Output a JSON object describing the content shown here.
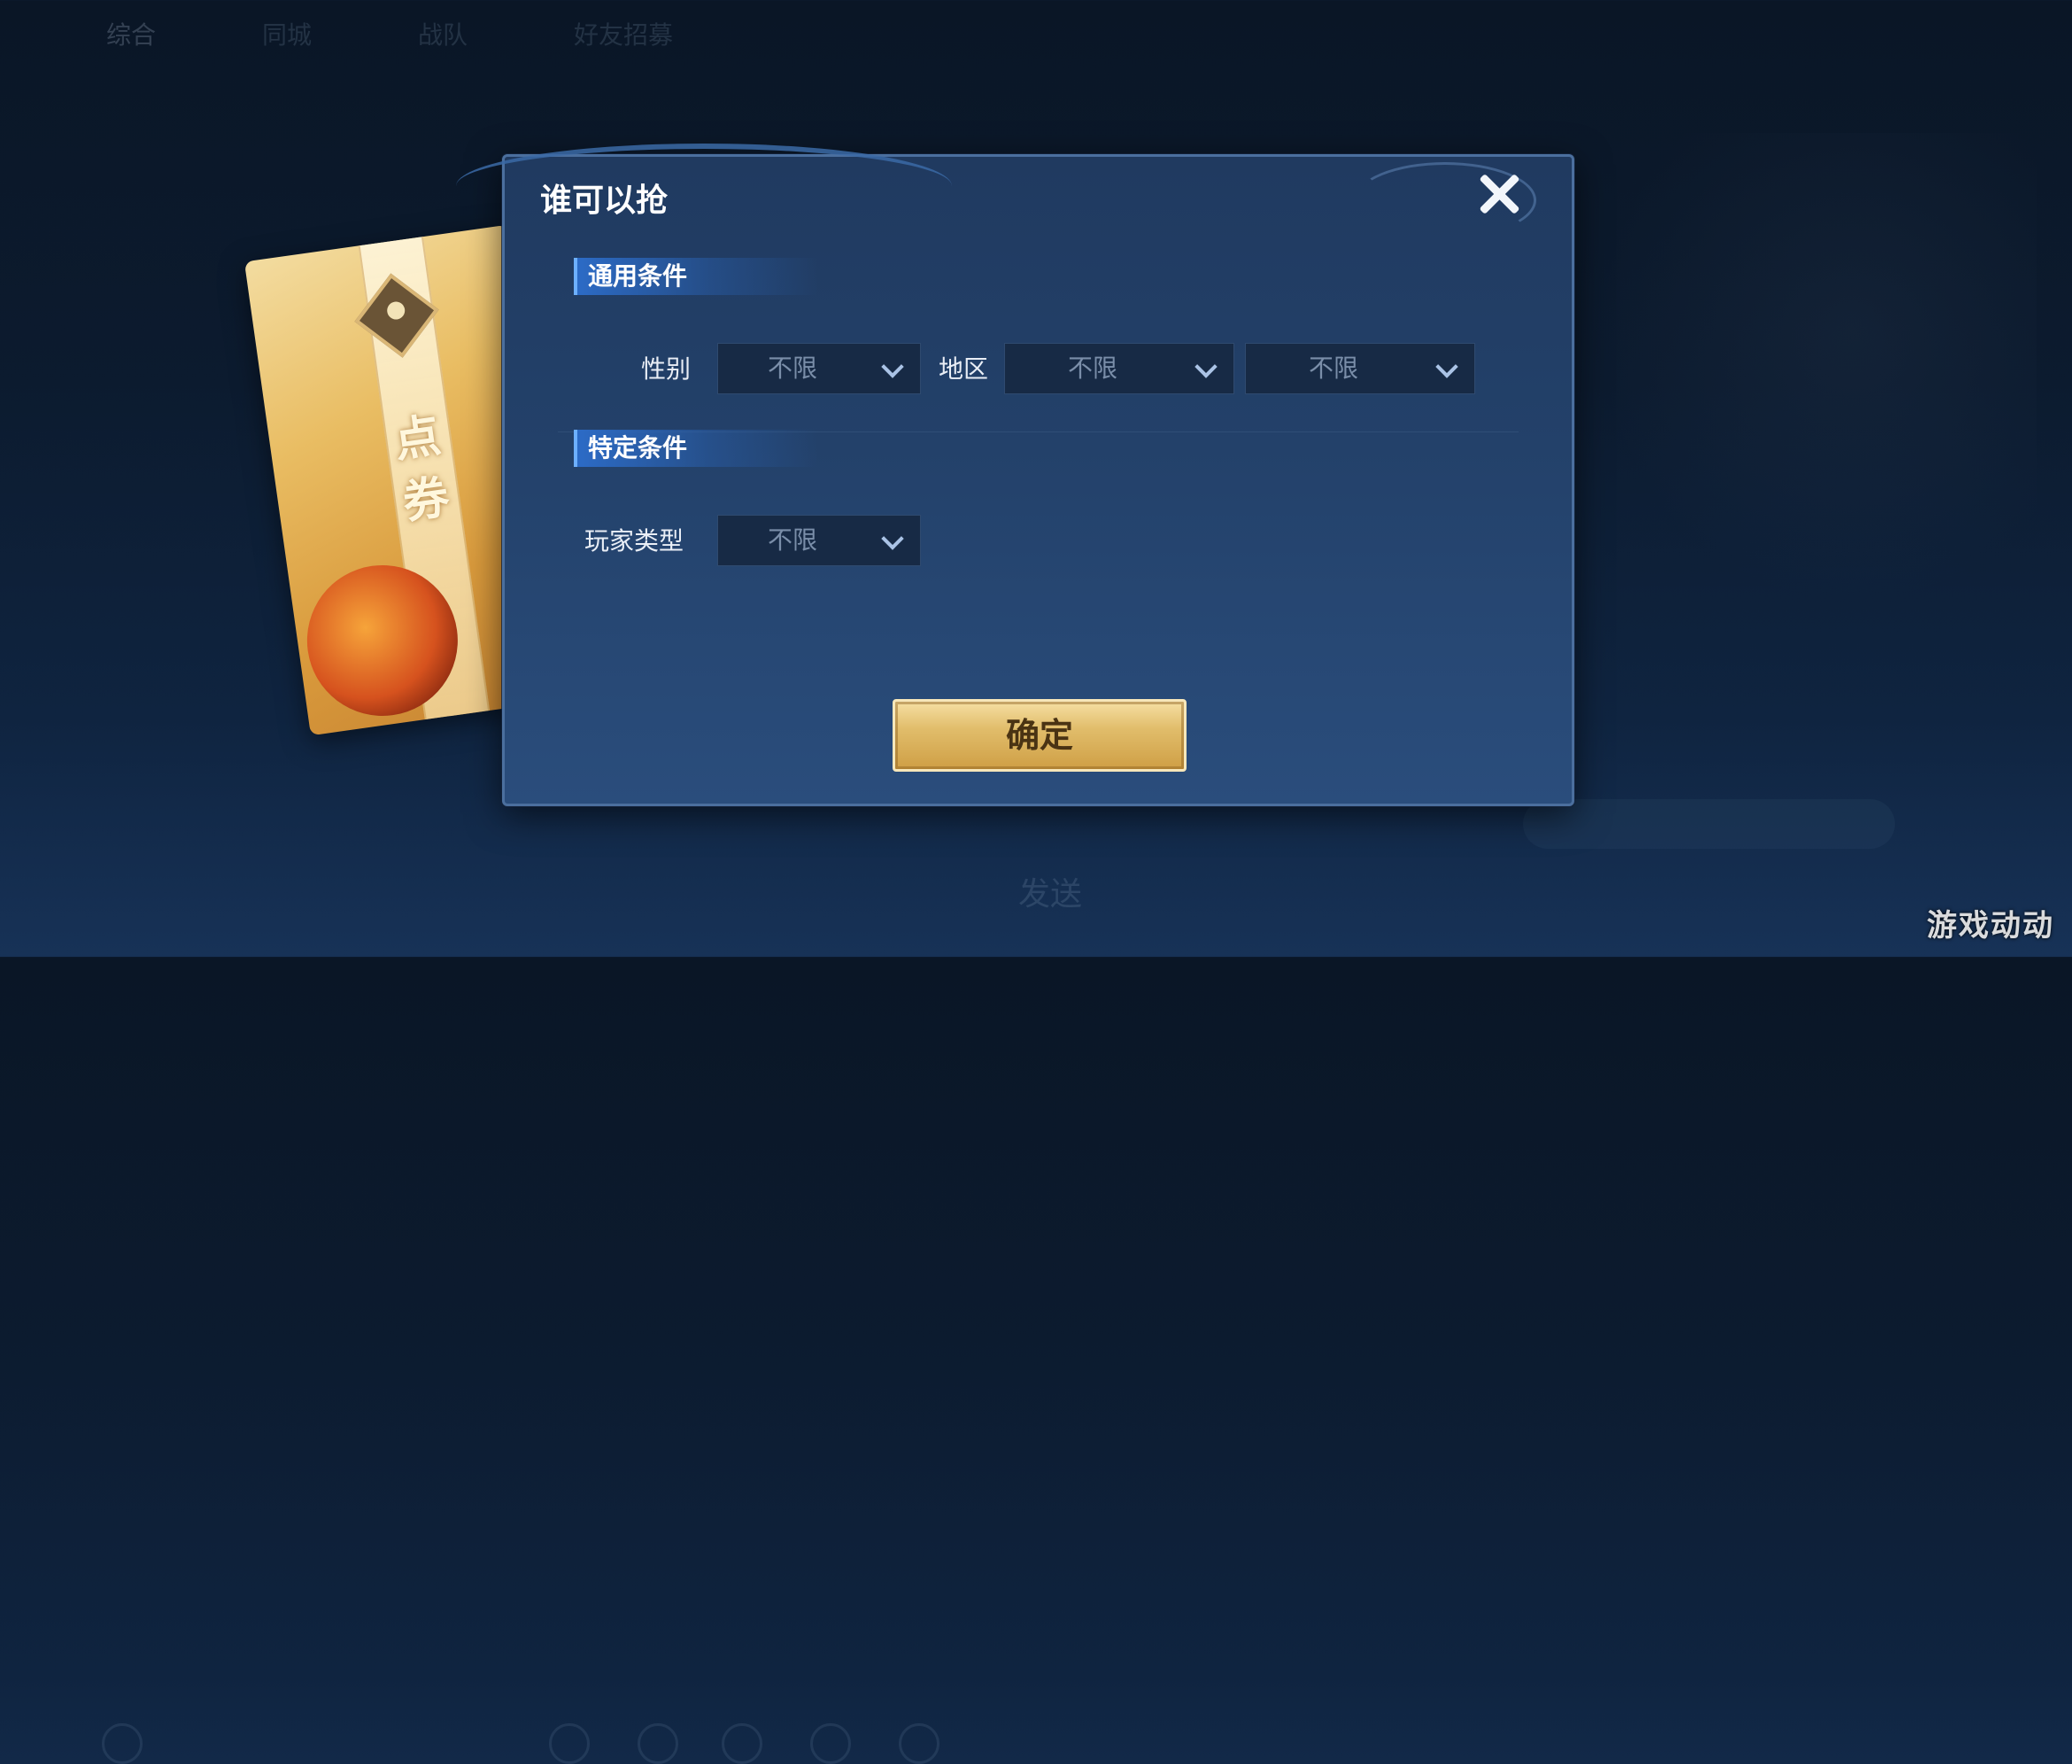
{
  "background": {
    "tabs": [
      "综合",
      "同城",
      "战队",
      "好友招募"
    ],
    "send_label": "发送",
    "watermark": "游戏动动"
  },
  "packet": {
    "label": "点券"
  },
  "dialog": {
    "title": "谁可以抢",
    "sections": {
      "general": {
        "title": "通用条件",
        "gender_label": "性别",
        "gender_value": "不限",
        "region_label": "地区",
        "region_value1": "不限",
        "region_value2": "不限"
      },
      "specific": {
        "title": "特定条件",
        "player_type_label": "玩家类型",
        "player_type_value": "不限"
      }
    },
    "confirm_label": "确定"
  },
  "colors": {
    "dialog_bg": "#23416a",
    "section_accent": "#2c6bc6",
    "confirm_gold": "#e1bd6b"
  }
}
